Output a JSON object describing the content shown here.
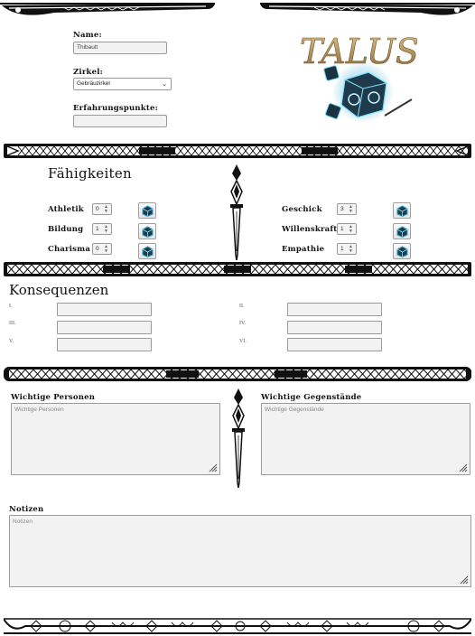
{
  "character": {
    "name_label": "Name:",
    "name_value": "Thibault",
    "circle_label": "Zirkel:",
    "circle_value": "Gebräuzirkel",
    "xp_label": "Erfahrungspunkte:",
    "xp_value": ""
  },
  "logo": {
    "text": "TALUS"
  },
  "skills": {
    "title": "Fähigkeiten",
    "left": [
      {
        "label": "Athletik",
        "value": "0"
      },
      {
        "label": "Bildung",
        "value": "1"
      },
      {
        "label": "Charisma",
        "value": "0"
      }
    ],
    "right": [
      {
        "label": "Geschick",
        "value": "3"
      },
      {
        "label": "Willenskraft",
        "value": "1"
      },
      {
        "label": "Empathie",
        "value": "1"
      }
    ]
  },
  "consequences": {
    "title": "Konsequenzen",
    "numerals": [
      "I.",
      "II.",
      "III.",
      "IV.",
      "V.",
      "VI."
    ]
  },
  "people": {
    "label": "Wichtige Personen",
    "placeholder": "Wichtige Personen"
  },
  "items": {
    "label": "Wichtige Gegenstände",
    "placeholder": "Wichtige Gegenstände"
  },
  "notes": {
    "label": "Notizen",
    "placeholder": "Notizen"
  },
  "colors": {
    "ink": "#111111",
    "field_bg": "#f2f2f2",
    "field_border": "#9a9a9a",
    "logo_gold": "#b8945a",
    "dice_teal": "#2ea3c9"
  }
}
